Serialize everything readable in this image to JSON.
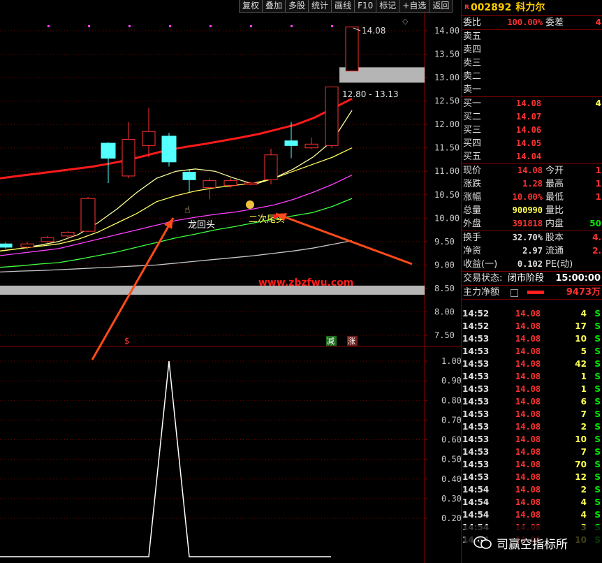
{
  "toolbar": [
    "复权",
    "叠加",
    "多股",
    "统计",
    "画线",
    "F10",
    "标记",
    "+自选",
    "返回"
  ],
  "stock": {
    "market_tag": "R",
    "code": "002892",
    "name": "科力尔"
  },
  "quote": {
    "weibi_label": "委比",
    "weibi": "100.00%",
    "weicha_label": "委差",
    "weicha": "4",
    "sell": [
      {
        "label": "卖五"
      },
      {
        "label": "卖四"
      },
      {
        "label": "卖三"
      },
      {
        "label": "卖二"
      },
      {
        "label": "卖一"
      }
    ],
    "buy": [
      {
        "label": "买一",
        "price": "14.08",
        "vol": "4"
      },
      {
        "label": "买二",
        "price": "14.07"
      },
      {
        "label": "买三",
        "price": "14.06"
      },
      {
        "label": "买四",
        "price": "14.05"
      },
      {
        "label": "买五",
        "price": "14.04"
      }
    ],
    "stats": [
      {
        "l1": "现价",
        "v1": "14.08",
        "l2": "今开",
        "v2": "1"
      },
      {
        "l1": "涨跌",
        "v1": "1.28",
        "l2": "最高",
        "v2": "1"
      },
      {
        "l1": "涨幅",
        "v1": "10.00%",
        "l2": "最低",
        "v2": "1"
      },
      {
        "l1": "总量",
        "v1": "900990",
        "l2": "量比",
        "v2": ""
      },
      {
        "l1": "外盘",
        "v1": "391818",
        "l2": "内盘",
        "v2": "50"
      }
    ],
    "stats2": [
      {
        "l1": "换手",
        "v1": "32.70%",
        "l2": "股本",
        "v2": "4."
      },
      {
        "l1": "净资",
        "v1": "2.97",
        "l2": "流通",
        "v2": "2."
      },
      {
        "l1": "收益(一)",
        "v1": "0.102",
        "l2": "PE(动)",
        "v2": ""
      }
    ],
    "status_label": "交易状态:",
    "status": "闭市阶段",
    "status_time": "15:00:00",
    "net_label": "主力净额",
    "net_value": "9473万"
  },
  "ticks": [
    {
      "t": "14:52",
      "p": "14.08",
      "v": "4",
      "s": "S"
    },
    {
      "t": "14:52",
      "p": "14.08",
      "v": "17",
      "s": "S"
    },
    {
      "t": "14:53",
      "p": "14.08",
      "v": "10",
      "s": "S"
    },
    {
      "t": "14:53",
      "p": "14.08",
      "v": "5",
      "s": "S"
    },
    {
      "t": "14:53",
      "p": "14.08",
      "v": "42",
      "s": "S"
    },
    {
      "t": "14:53",
      "p": "14.08",
      "v": "1",
      "s": "S"
    },
    {
      "t": "14:53",
      "p": "14.08",
      "v": "1",
      "s": "S"
    },
    {
      "t": "14:53",
      "p": "14.08",
      "v": "6",
      "s": "S"
    },
    {
      "t": "14:53",
      "p": "14.08",
      "v": "7",
      "s": "S"
    },
    {
      "t": "14:53",
      "p": "14.08",
      "v": "2",
      "s": "S"
    },
    {
      "t": "14:53",
      "p": "14.08",
      "v": "10",
      "s": "S"
    },
    {
      "t": "14:53",
      "p": "14.08",
      "v": "7",
      "s": "S"
    },
    {
      "t": "14:53",
      "p": "14.08",
      "v": "70",
      "s": "S"
    },
    {
      "t": "14:53",
      "p": "14.08",
      "v": "12",
      "s": "S"
    },
    {
      "t": "14:54",
      "p": "14.08",
      "v": "2",
      "s": "S"
    },
    {
      "t": "14:54",
      "p": "14.08",
      "v": "4",
      "s": "S"
    },
    {
      "t": "14:54",
      "p": "14.08",
      "v": "4",
      "s": "S"
    },
    {
      "t": "14:54",
      "p": "14.08",
      "v": "3",
      "s": "S"
    },
    {
      "t": "14:54",
      "p": "14.08",
      "v": "10",
      "s": "S"
    }
  ],
  "watermark": "司赢空指标所",
  "chart_data": {
    "type": "candlestick",
    "price_axis": {
      "ticks": [
        "14.00",
        "13.50",
        "13.00",
        "12.50",
        "12.00",
        "11.50",
        "11.00",
        "10.50",
        "10.00",
        "9.50",
        "9.00",
        "8.50",
        "8.00",
        "7.50"
      ],
      "range": [
        7.3,
        14.5
      ]
    },
    "candles": [
      {
        "o": 9.45,
        "c": 9.38,
        "h": 9.48,
        "l": 9.35
      },
      {
        "o": 9.38,
        "c": 9.45,
        "h": 9.5,
        "l": 9.33
      },
      {
        "o": 9.5,
        "c": 9.58,
        "h": 9.62,
        "l": 9.46
      },
      {
        "o": 9.62,
        "c": 9.7,
        "h": 9.72,
        "l": 9.55
      },
      {
        "o": 9.72,
        "c": 10.42,
        "h": 10.45,
        "l": 9.7
      },
      {
        "o": 11.6,
        "c": 11.28,
        "h": 11.62,
        "l": 10.75
      },
      {
        "o": 10.9,
        "c": 11.68,
        "h": 12.05,
        "l": 10.85
      },
      {
        "o": 11.55,
        "c": 11.85,
        "h": 12.35,
        "l": 11.3
      },
      {
        "o": 11.75,
        "c": 11.2,
        "h": 11.82,
        "l": 11.1
      },
      {
        "o": 10.98,
        "c": 10.82,
        "h": 11.05,
        "l": 10.55
      },
      {
        "o": 10.65,
        "c": 10.8,
        "h": 10.85,
        "l": 10.4
      },
      {
        "o": 10.7,
        "c": 10.8,
        "h": 10.85,
        "l": 10.65
      },
      {
        "o": 10.73,
        "c": 10.75,
        "h": 10.78,
        "l": 10.7
      },
      {
        "o": 10.82,
        "c": 11.35,
        "h": 11.48,
        "l": 10.72
      },
      {
        "o": 11.65,
        "c": 11.55,
        "h": 12.05,
        "l": 11.28
      },
      {
        "o": 11.5,
        "c": 11.58,
        "h": 11.72,
        "l": 11.48
      },
      {
        "o": 11.55,
        "c": 12.8,
        "h": 12.8,
        "l": 11.5
      },
      {
        "o": 13.14,
        "c": 14.08,
        "h": 14.08,
        "l": 13.14
      }
    ],
    "ma_series": [
      {
        "color": "#ff1a1a",
        "values": [
          10.85,
          10.9,
          10.95,
          11.0,
          11.05,
          11.1,
          11.17,
          11.25,
          11.35,
          11.45,
          11.52,
          11.58,
          11.65,
          11.72,
          11.8,
          11.9,
          12.0,
          12.15,
          12.35,
          12.55
        ]
      },
      {
        "color": "#ffffa0",
        "values": [
          9.3,
          9.35,
          9.42,
          9.5,
          9.65,
          9.9,
          10.2,
          10.55,
          10.85,
          11.0,
          11.05,
          11.0,
          10.85,
          10.72,
          10.85,
          11.05,
          11.3,
          11.65,
          12.3
        ]
      },
      {
        "color": "#ffff60",
        "values": [
          9.3,
          9.35,
          9.4,
          9.45,
          9.55,
          9.7,
          9.9,
          10.1,
          10.35,
          10.48,
          10.58,
          10.65,
          10.7,
          10.75,
          10.85,
          11.0,
          11.15,
          11.3,
          11.5
        ]
      },
      {
        "color": "#ff40ff",
        "values": [
          9.2,
          9.25,
          9.3,
          9.35,
          9.45,
          9.55,
          9.65,
          9.75,
          9.85,
          9.95,
          10.02,
          10.08,
          10.13,
          10.2,
          10.28,
          10.4,
          10.55,
          10.72,
          10.92
        ]
      },
      {
        "color": "#40ff40",
        "values": [
          8.95,
          8.98,
          9.02,
          9.05,
          9.12,
          9.2,
          9.28,
          9.38,
          9.48,
          9.58,
          9.66,
          9.75,
          9.82,
          9.9,
          9.98,
          10.05,
          10.12,
          10.25,
          10.42
        ]
      },
      {
        "color": "#c8c8c8",
        "values": [
          8.85,
          8.87,
          8.88,
          8.9,
          8.92,
          8.94,
          8.96,
          8.98,
          9.0,
          9.04,
          9.08,
          9.12,
          9.16,
          9.2,
          9.25,
          9.3,
          9.36,
          9.44,
          9.52
        ]
      }
    ],
    "resistance_band": {
      "label": "12.80 - 13.13",
      "low": 12.8,
      "high": 13.13
    },
    "support_band_price": 8.5,
    "high_label": "14.08",
    "annotations": [
      "龙回头",
      "二次尾买"
    ],
    "red_text": "www.zbzfwu.com",
    "signal_markers": [
      "$",
      "减",
      "涨"
    ],
    "indicator": {
      "y_ticks": [
        "1.00",
        "0.90",
        "0.80",
        "0.70",
        "0.60",
        "0.50",
        "0.40",
        "0.30",
        "0.20"
      ],
      "values": [
        0,
        0,
        0,
        0,
        0,
        0,
        0,
        0,
        1,
        0,
        0,
        0,
        0,
        0,
        0,
        0,
        0
      ]
    }
  }
}
